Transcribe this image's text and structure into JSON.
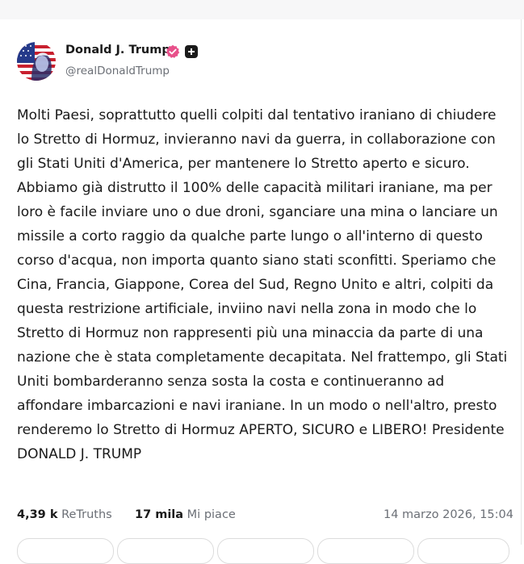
{
  "post": {
    "author_name": "Donald J. Trump",
    "handle": "@realDonaldTrump",
    "text": "Molti Paesi, soprattutto quelli colpiti dal tentativo iraniano di chiudere lo Stretto di Hormuz, invieranno navi da guerra, in collaborazione con gli Stati Uniti d'America, per mantenere lo Stretto aperto e sicuro. Abbiamo già distrutto il 100% delle capacità militari iraniane, ma per loro è facile inviare uno o due droni, sganciare una mina o lanciare un missile a corto raggio da qualche parte lungo o all'interno di questo corso d'acqua, non importa quanto siano stati sconfitti. Speriamo che Cina, Francia, Giappone, Corea del Sud, Regno Unito e altri, colpiti da questa restrizione artificiale, inviino navi nella zona in modo che lo Stretto di Hormuz non rappresenti più una minaccia da parte di una nazione che è stata completamente decapitata. Nel frattempo, gli Stati Uniti bombarderanno senza sosta la costa e continueranno ad affondare imbarcazioni e navi iraniane. In un modo o nell'altro, presto renderemo lo Stretto di Hormuz APERTO, SICURO e LIBERO! Presidente DONALD J. TRUMP"
  },
  "stats": {
    "retruths_count": "4,39 k",
    "retruths_label": "ReTruths",
    "likes_count": "17 mila",
    "likes_label": "Mi piace",
    "timestamp": "14 marzo 2026, 15:04"
  },
  "icons": {
    "verified": "verified-badge-icon",
    "plus": "plus-badge-icon"
  },
  "colors": {
    "verified": "#e8508a",
    "secondary_text": "#6b6f76"
  }
}
